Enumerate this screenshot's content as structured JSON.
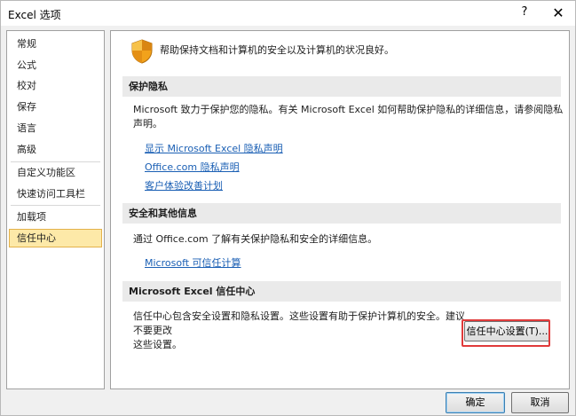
{
  "window": {
    "title": "Excel 选项",
    "help_label": "?",
    "close_label": "✕"
  },
  "sidebar": {
    "items": [
      {
        "label": "常规"
      },
      {
        "label": "公式"
      },
      {
        "label": "校对"
      },
      {
        "label": "保存"
      },
      {
        "label": "语言"
      },
      {
        "label": "高级"
      },
      {
        "label": "自定义功能区"
      },
      {
        "label": "快速访问工具栏"
      },
      {
        "label": "加载项"
      },
      {
        "label": "信任中心"
      }
    ],
    "active_index": 9
  },
  "content": {
    "intro": "帮助保持文档和计算机的安全以及计算机的状况良好。",
    "privacy": {
      "header": "保护隐私",
      "text_line1": "Microsoft 致力于保护您的隐私。有关 Microsoft Excel 如何帮助保护隐私的详细信息，请参阅隐私",
      "text_line2": "声明。",
      "links": [
        "显示 Microsoft Excel 隐私声明",
        "Office.com 隐私声明",
        "客户体验改善计划"
      ]
    },
    "security": {
      "header": "安全和其他信息",
      "text": "通过 Office.com 了解有关保护隐私和安全的详细信息。",
      "link": "Microsoft 可信任计算"
    },
    "trust_center": {
      "header": "Microsoft Excel 信任中心",
      "text_line1": "信任中心包含安全设置和隐私设置。这些设置有助于保护计算机的安全。建议",
      "text_line2": "不要更改",
      "text_line3": "这些设置。",
      "button": "信任中心设置(T)..."
    }
  },
  "footer": {
    "ok": "确定",
    "cancel": "取消"
  },
  "colors": {
    "active_item_bg": "#fde9a8",
    "link": "#1a5fb4",
    "highlight": "#e03a3a"
  }
}
